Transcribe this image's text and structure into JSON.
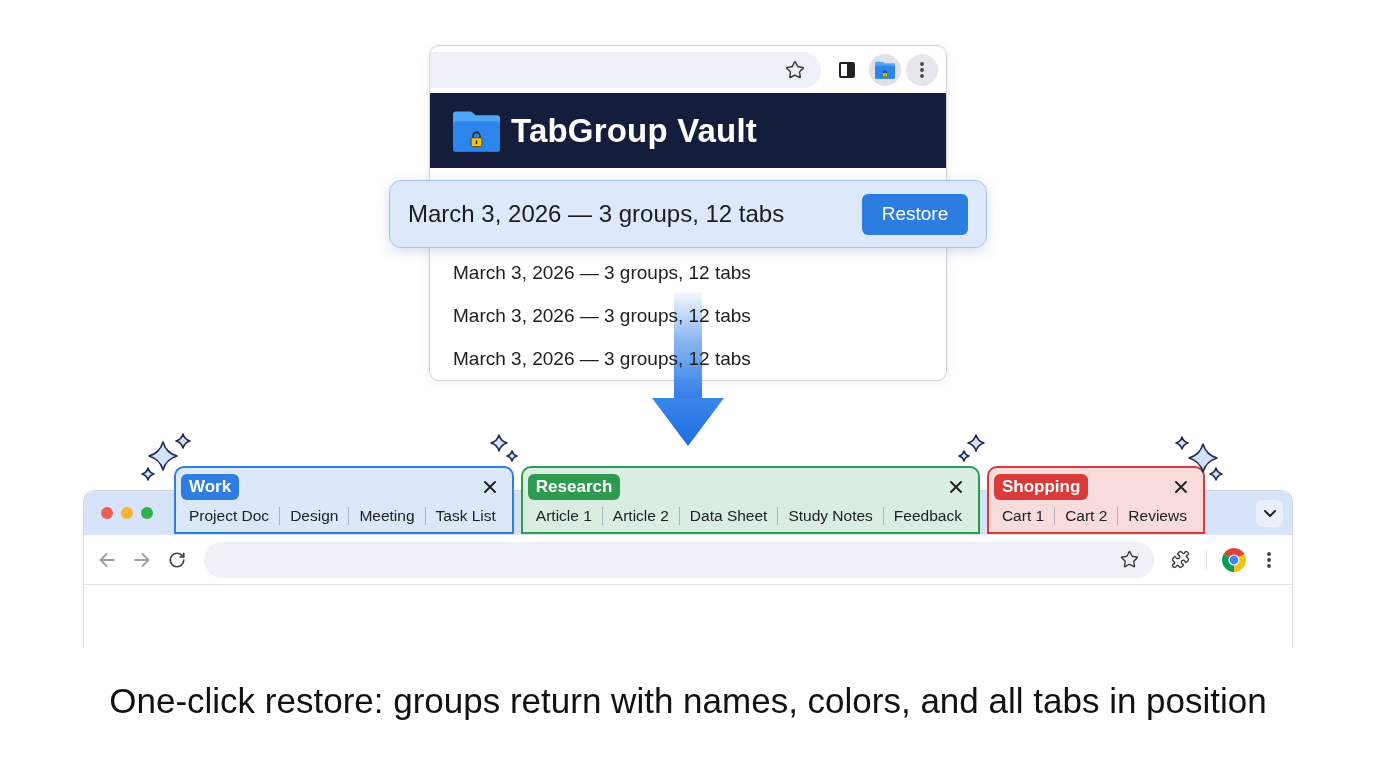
{
  "popup": {
    "title": "TabGroup Vault",
    "restore_button": "Restore",
    "snapshots": [
      {
        "label": "March 3, 2026 — 3 groups, 12 tabs",
        "selected": true
      },
      {
        "label": "March 3, 2026 — 3 groups, 12 tabs",
        "selected": false
      },
      {
        "label": "March 3, 2026 — 3 groups, 12 tabs",
        "selected": false
      },
      {
        "label": "March 3, 2026 — 3 groups, 12 tabs",
        "selected": false
      }
    ]
  },
  "browser": {
    "tab_groups": [
      {
        "name": "Work",
        "color": "#2f7de1",
        "tabs": [
          "Project Doc",
          "Design",
          "Meeting",
          "Task List"
        ]
      },
      {
        "name": "Research",
        "color": "#2e9b50",
        "tabs": [
          "Article 1",
          "Article 2",
          "Data Sheet",
          "Study Notes",
          "Feedback"
        ]
      },
      {
        "name": "Shopping",
        "color": "#d93a3a",
        "tabs": [
          "Cart 1",
          "Cart 2",
          "Reviews"
        ]
      }
    ]
  },
  "caption": "One-click restore: groups return with names, colors, and all tabs in position"
}
